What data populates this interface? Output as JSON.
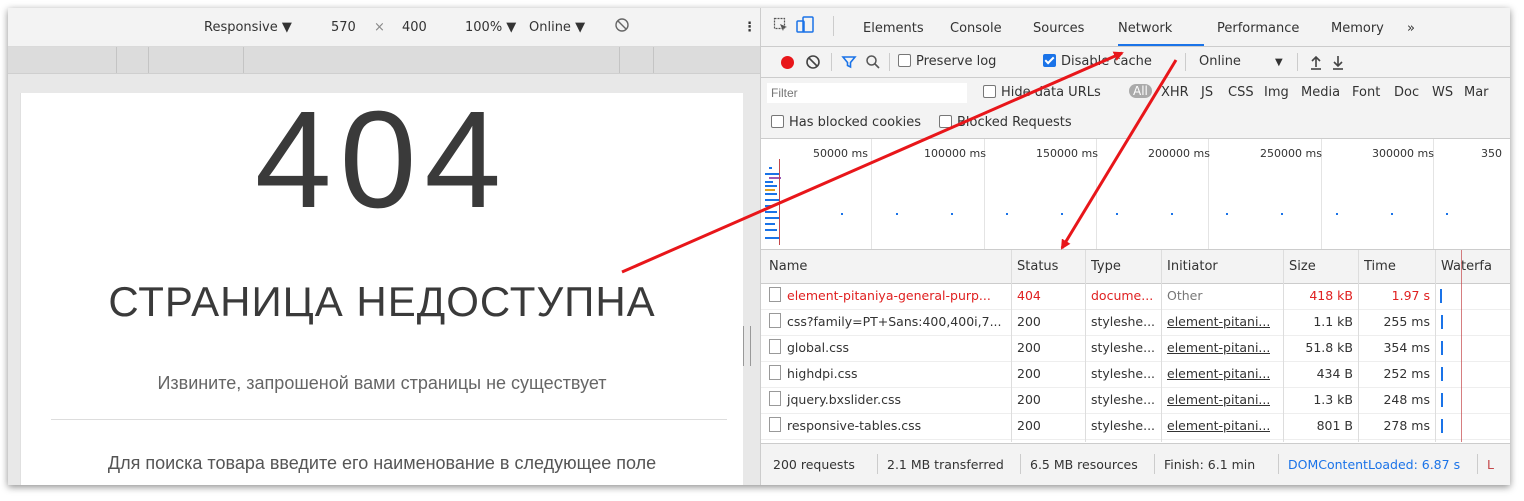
{
  "device_toolbar": {
    "mode": "Responsive ▼",
    "width": "570",
    "times": "×",
    "height": "400",
    "zoom": "100% ▼",
    "throttle": "Online ▼",
    "more": "⋮"
  },
  "page": {
    "code": "404",
    "title": "СТРАНИЦА НЕДОСТУПНА",
    "subtitle": "Извините, запрошеной вами страницы не существует",
    "search_hint": "Для поиска товара введите его наименование в следующее поле"
  },
  "devtools": {
    "tabs": [
      {
        "label": "Elements"
      },
      {
        "label": "Console"
      },
      {
        "label": "Sources"
      },
      {
        "label": "Network"
      },
      {
        "label": "Performance"
      },
      {
        "label": "Memory"
      },
      {
        "label": "»"
      }
    ],
    "active_tab": "Network",
    "toolbar": {
      "preserve_log": "Preserve log",
      "disable_cache": "Disable cache",
      "throttle": "Online",
      "throttle_arrow": "▼"
    },
    "filter": {
      "placeholder": "Filter",
      "hide_data_urls": "Hide data URLs",
      "types": [
        "All",
        "XHR",
        "JS",
        "CSS",
        "Img",
        "Media",
        "Font",
        "Doc",
        "WS",
        "Mar"
      ]
    },
    "blocked": {
      "has_blocked_cookies": "Has blocked cookies",
      "blocked_requests": "Blocked Requests"
    },
    "timeline_labels": [
      "50000 ms",
      "100000 ms",
      "150000 ms",
      "200000 ms",
      "250000 ms",
      "300000 ms",
      "350"
    ],
    "columns": [
      "Name",
      "Status",
      "Type",
      "Initiator",
      "Size",
      "Time",
      "Waterfa"
    ],
    "rows": [
      {
        "name": "element-pitaniya-general-purp...",
        "status": "404",
        "type": "docume...",
        "initiator": "Other",
        "size": "418 kB",
        "time": "1.97 s",
        "error": true
      },
      {
        "name": "css?family=PT+Sans:400,400i,7...",
        "status": "200",
        "type": "styleshe...",
        "initiator": "element-pitani...",
        "size": "1.1 kB",
        "time": "255 ms",
        "error": false
      },
      {
        "name": "global.css",
        "status": "200",
        "type": "styleshe...",
        "initiator": "element-pitani...",
        "size": "51.8 kB",
        "time": "354 ms",
        "error": false
      },
      {
        "name": "highdpi.css",
        "status": "200",
        "type": "styleshe...",
        "initiator": "element-pitani...",
        "size": "434 B",
        "time": "252 ms",
        "error": false
      },
      {
        "name": "jquery.bxslider.css",
        "status": "200",
        "type": "styleshe...",
        "initiator": "element-pitani...",
        "size": "1.3 kB",
        "time": "248 ms",
        "error": false
      },
      {
        "name": "responsive-tables.css",
        "status": "200",
        "type": "styleshe...",
        "initiator": "element-pitani...",
        "size": "801 B",
        "time": "278 ms",
        "error": false
      }
    ],
    "status_bar": {
      "requests": "200 requests",
      "transferred": "2.1 MB transferred",
      "resources": "6.5 MB resources",
      "finish": "Finish: 6.1 min",
      "dom_loaded": "DOMContentLoaded: 6.87 s",
      "load_cut": "L"
    }
  },
  "colors": {
    "accent": "#1a73e8",
    "error": "#e02020",
    "annotation_arrow": "#e8161a",
    "record": "#e8161a"
  }
}
